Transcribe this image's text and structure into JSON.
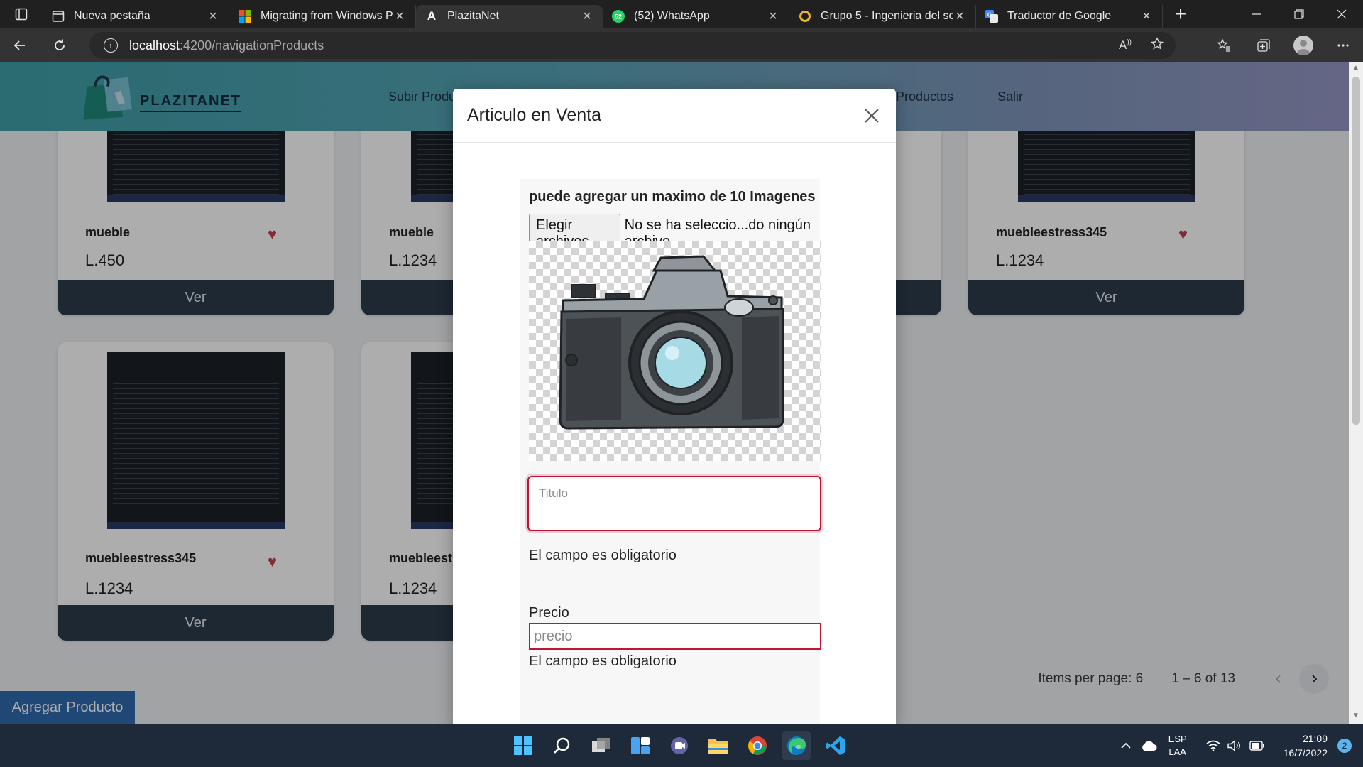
{
  "browser": {
    "tabs": [
      {
        "title": "Nueva pestaña",
        "icon": "new-tab-page-icon"
      },
      {
        "title": "Migrating from Windows Po",
        "icon": "microsoft-logo-icon"
      },
      {
        "title": "PlazitaNet",
        "icon": "angular-logo-icon",
        "active": true
      },
      {
        "title": "(52) WhatsApp",
        "icon": "whatsapp-icon",
        "badge": "52"
      },
      {
        "title": "Grupo 5 - Ingenieria del sof",
        "icon": "github-icon"
      },
      {
        "title": "Traductor de Google",
        "icon": "google-translate-icon"
      }
    ],
    "url_host": "localhost",
    "url_rest": ":4200/navigationProducts"
  },
  "site": {
    "logo_text": "PLAZITANET",
    "nav": {
      "upload": "Subir Produ",
      "products": "Productos",
      "logout": "Salir"
    }
  },
  "products": [
    {
      "title": "mueble",
      "price": "L.450",
      "button": "Ver",
      "favorite": true
    },
    {
      "title": "mueble",
      "price": "L.1234",
      "button": "Ver",
      "favorite": false
    },
    {
      "title": "muebleestress345",
      "price": "L.1234",
      "button": "Ver",
      "favorite": true
    },
    {
      "title": "muebleestress345",
      "price": "L.1234",
      "button": "Ver",
      "favorite": true
    },
    {
      "title": "muebleestr",
      "price": "L.1234",
      "button": "Ver",
      "favorite": false
    }
  ],
  "paginator": {
    "items_per_page_label": "Items per page: 6",
    "range": "1 – 6 of 13"
  },
  "add_product_button": "Agregar Producto",
  "modal": {
    "title": "Articulo en Venta",
    "upload_hint": "puede agregar un maximo de 10 Imagenes",
    "file_button": "Elegir archivos",
    "file_status": "No se ha seleccio...do ningún archivo",
    "title_placeholder": "Titulo",
    "required_error": "El campo es obligatorio",
    "price_label": "Precio",
    "price_placeholder": "precio",
    "required_error_2": "El campo es obligatorio"
  },
  "taskbar": {
    "apps": [
      "windows-start-icon",
      "search-icon",
      "task-view-icon",
      "widgets-icon",
      "teams-chat-icon",
      "file-explorer-icon",
      "chrome-icon",
      "edge-icon",
      "vscode-icon"
    ],
    "lang_top": "ESP",
    "lang_bottom": "LAA",
    "time": "21:09",
    "date": "16/7/2022",
    "notifications": "2"
  },
  "colors": {
    "header_gradient_start": "#3e9fa8",
    "header_gradient_end": "#9597c4",
    "card_button": "#2d3b4a",
    "primary_button": "#2f6ab0",
    "error_border": "#c31432",
    "heart": "#c0414e"
  }
}
